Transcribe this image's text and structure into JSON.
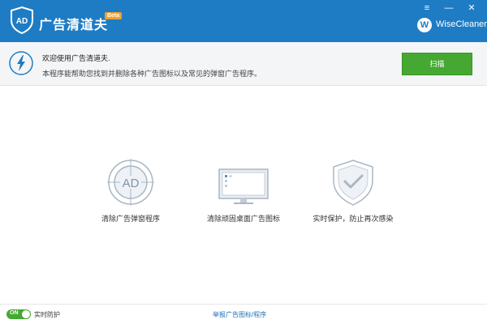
{
  "titlebar": {
    "logo_text": "AD",
    "app_name": "广告清道夫",
    "beta_label": "Beta",
    "brand_badge": "W",
    "brand_name": "WiseCleaner",
    "menu_glyph": "≡",
    "minimize_glyph": "—",
    "close_glyph": "✕",
    "accent_color": "#1e7cc4"
  },
  "banner": {
    "icon": "lightning-icon",
    "title": "欢迎使用广告清道夫.",
    "description": "本程序能帮助您找到并删除各种广告图标以及常见的弹窗广告程序。",
    "scan_label": "扫描",
    "scan_color": "#45a832"
  },
  "features": [
    {
      "icon": "ad-target-icon",
      "label": "清除广告弹窗程序",
      "icon_text": "AD"
    },
    {
      "icon": "desktop-monitor-icon",
      "label": "清除顽固桌面广告图标"
    },
    {
      "icon": "shield-check-icon",
      "label": "实时保护，防止再次感染"
    }
  ],
  "footer": {
    "toggle_state": "ON",
    "realtime_label": "实时防护",
    "report_link": "举报广告图标/程序"
  }
}
